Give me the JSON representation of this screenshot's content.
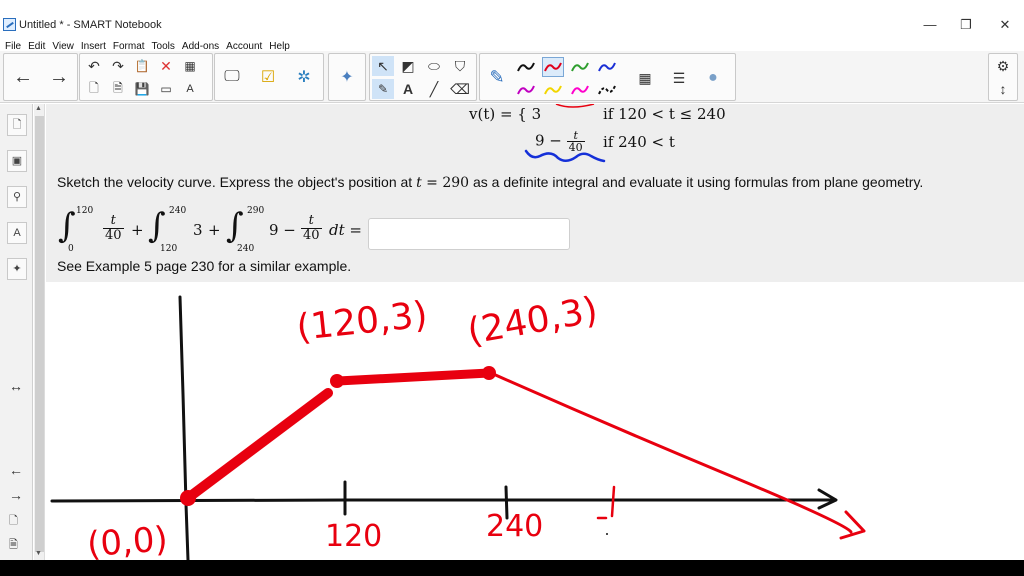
{
  "window": {
    "title": "Untitled * - SMART Notebook",
    "controls": [
      "minimize",
      "restore",
      "close"
    ]
  },
  "menu": [
    "File",
    "Edit",
    "View",
    "Insert",
    "Format",
    "Tools",
    "Add-ons",
    "Account",
    "Help"
  ],
  "toolbar": {
    "pen_colors": [
      "#111111",
      "#e0001b",
      "#2e9e2e",
      "#1b2fd6",
      "#c000c0",
      "#f2d600",
      "#ff00cc",
      "#111111"
    ],
    "active_pen_color": "#e0001b"
  },
  "question": {
    "piecewise_head": "v(t) = {",
    "row2_value": "3",
    "row2_cond": "if 120 < t ≤ 240",
    "row3_value_prefix": "9 − ",
    "row3_frac_num": "t",
    "row3_frac_den": "40",
    "row3_cond": "if 240 < t",
    "prompt_a": "Sketch the velocity curve. Express the object's position at ",
    "prompt_t": "t",
    "prompt_eq": " = 290",
    "prompt_b": " as a definite integral and evaluate it using formulas from plane geometry.",
    "integral": {
      "i1_upper": "120",
      "i1_lower": "0",
      "i1_num": "t",
      "i1_den": "40",
      "plus1": "+",
      "i2_upper": "240",
      "i2_lower": "120",
      "i2_body": "3",
      "plus2": "+",
      "i3_upper": "290",
      "i3_lower": "240",
      "i3_body": "9 −",
      "i3_num": "t",
      "i3_den": "40",
      "dt": "dt =",
      "answer": ""
    },
    "hint": "See Example 5 page 230 for a similar example."
  },
  "annotations": {
    "ink_color": "#e8000f",
    "point_labels": [
      "(120,3)",
      "(240,3)",
      "(0,0)"
    ],
    "tick_labels": [
      "120",
      "240"
    ]
  }
}
